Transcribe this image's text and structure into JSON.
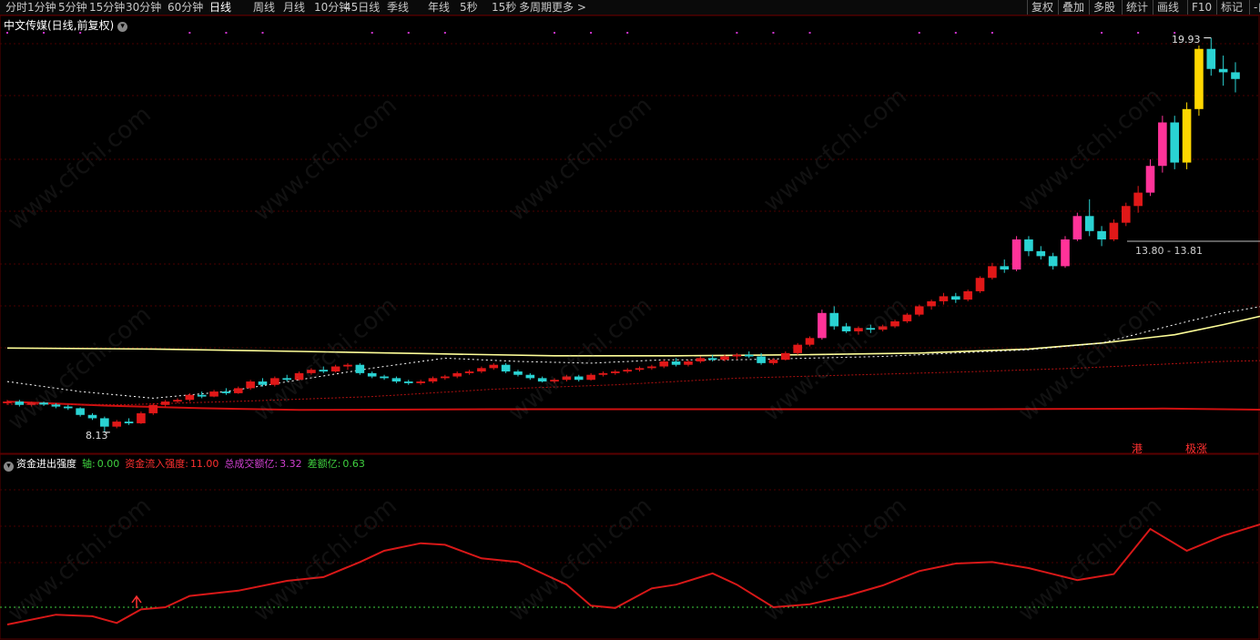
{
  "toolbar": {
    "left_tabs": [
      "分时",
      "1分钟",
      "5分钟",
      "15分钟",
      "30分钟",
      "60分钟",
      "日线",
      "周线",
      "月线",
      "10分钟",
      "45日线",
      "季线",
      "年线",
      "5秒",
      "15秒",
      "多周期",
      "更多 >"
    ],
    "right_tabs": [
      "复权",
      "叠加",
      "多股",
      "统计",
      "画线",
      "F10",
      "标记",
      "-自"
    ]
  },
  "price_panel": {
    "title": "中文传媒(日线,前复权)",
    "high_label": "19.93",
    "low_label": "8.13",
    "crosshair_label": "13.80 - 13.81",
    "tag_hk": "港",
    "tag_rise": "极涨"
  },
  "indicator_panel": {
    "name": "资金进出强度",
    "fields": [
      {
        "label": "轴:",
        "value": "0.00",
        "color": "#3fd13f"
      },
      {
        "label": "资金流入强度:",
        "value": "11.00",
        "color": "#ff3030"
      },
      {
        "label": "总成交额亿:",
        "value": "3.32",
        "color": "#d040d0"
      },
      {
        "label": "差额亿:",
        "value": "0.63",
        "color": "#3fd13f"
      }
    ]
  },
  "watermark": "www.cfchi.com",
  "colors": {
    "up": "#e01818",
    "down": "#2ad3d3",
    "strong_up": "#ff3399",
    "limit_up": "#ffd700",
    "ma_long": "#ffff99",
    "ma_short": "#ffffff",
    "ind_line": "#d81818",
    "grid": "#4a0000"
  },
  "chart_data": [
    {
      "type": "candlestick",
      "title": "中文传媒(日线,前复权)",
      "ylim": [
        7.5,
        20.6
      ],
      "annotations": {
        "high": 19.93,
        "low": 8.13,
        "crosshair": "13.80 - 13.81"
      },
      "candles": [
        [
          9.0,
          9.1,
          8.95,
          9.05
        ],
        [
          9.05,
          9.1,
          8.9,
          8.95
        ],
        [
          8.95,
          9.05,
          8.9,
          9.02
        ],
        [
          9.02,
          9.05,
          8.92,
          8.96
        ],
        [
          8.96,
          9.0,
          8.85,
          8.9
        ],
        [
          8.9,
          8.95,
          8.8,
          8.85
        ],
        [
          8.85,
          8.88,
          8.6,
          8.65
        ],
        [
          8.65,
          8.7,
          8.5,
          8.55
        ],
        [
          8.55,
          8.6,
          8.13,
          8.3
        ],
        [
          8.3,
          8.5,
          8.25,
          8.45
        ],
        [
          8.45,
          8.55,
          8.35,
          8.4
        ],
        [
          8.4,
          8.75,
          8.38,
          8.7
        ],
        [
          8.7,
          9.0,
          8.65,
          8.95
        ],
        [
          8.95,
          9.1,
          8.9,
          9.05
        ],
        [
          9.05,
          9.15,
          9.0,
          9.1
        ],
        [
          9.1,
          9.3,
          9.05,
          9.25
        ],
        [
          9.25,
          9.35,
          9.15,
          9.2
        ],
        [
          9.2,
          9.4,
          9.18,
          9.35
        ],
        [
          9.35,
          9.45,
          9.25,
          9.3
        ],
        [
          9.3,
          9.5,
          9.28,
          9.45
        ],
        [
          9.45,
          9.7,
          9.4,
          9.65
        ],
        [
          9.65,
          9.75,
          9.5,
          9.55
        ],
        [
          9.55,
          9.8,
          9.5,
          9.75
        ],
        [
          9.75,
          9.85,
          9.65,
          9.7
        ],
        [
          9.7,
          9.95,
          9.68,
          9.9
        ],
        [
          9.9,
          10.05,
          9.85,
          10.0
        ],
        [
          10.0,
          10.1,
          9.9,
          9.95
        ],
        [
          9.95,
          10.15,
          9.92,
          10.1
        ],
        [
          10.1,
          10.2,
          10.0,
          10.15
        ],
        [
          10.15,
          10.2,
          9.85,
          9.9
        ],
        [
          9.9,
          9.95,
          9.75,
          9.8
        ],
        [
          9.8,
          9.85,
          9.7,
          9.75
        ],
        [
          9.75,
          9.8,
          9.6,
          9.65
        ],
        [
          9.65,
          9.7,
          9.55,
          9.6
        ],
        [
          9.6,
          9.7,
          9.55,
          9.65
        ],
        [
          9.65,
          9.8,
          9.6,
          9.75
        ],
        [
          9.75,
          9.85,
          9.7,
          9.8
        ],
        [
          9.8,
          9.95,
          9.75,
          9.9
        ],
        [
          9.9,
          10.0,
          9.85,
          9.95
        ],
        [
          9.95,
          10.1,
          9.9,
          10.05
        ],
        [
          10.05,
          10.2,
          10.0,
          10.15
        ],
        [
          10.15,
          10.2,
          9.9,
          9.95
        ],
        [
          9.95,
          10.0,
          9.8,
          9.85
        ],
        [
          9.85,
          9.9,
          9.7,
          9.75
        ],
        [
          9.75,
          9.8,
          9.62,
          9.65
        ],
        [
          9.65,
          9.75,
          9.6,
          9.7
        ],
        [
          9.7,
          9.85,
          9.65,
          9.8
        ],
        [
          9.8,
          9.85,
          9.65,
          9.7
        ],
        [
          9.7,
          9.9,
          9.68,
          9.85
        ],
        [
          9.85,
          9.95,
          9.8,
          9.9
        ],
        [
          9.9,
          10.0,
          9.85,
          9.95
        ],
        [
          9.95,
          10.05,
          9.9,
          10.0
        ],
        [
          10.0,
          10.1,
          9.95,
          10.05
        ],
        [
          10.05,
          10.15,
          10.0,
          10.1
        ],
        [
          10.1,
          10.3,
          10.05,
          10.25
        ],
        [
          10.25,
          10.35,
          10.1,
          10.15
        ],
        [
          10.15,
          10.3,
          10.1,
          10.25
        ],
        [
          10.25,
          10.4,
          10.2,
          10.35
        ],
        [
          10.35,
          10.45,
          10.25,
          10.3
        ],
        [
          10.3,
          10.45,
          10.25,
          10.4
        ],
        [
          10.4,
          10.5,
          10.3,
          10.45
        ],
        [
          10.45,
          10.55,
          10.35,
          10.4
        ],
        [
          10.4,
          10.5,
          10.15,
          10.2
        ],
        [
          10.2,
          10.35,
          10.15,
          10.3
        ],
        [
          10.3,
          10.55,
          10.28,
          10.5
        ],
        [
          10.5,
          10.8,
          10.45,
          10.75
        ],
        [
          10.75,
          11.0,
          10.7,
          10.95
        ],
        [
          10.95,
          11.8,
          10.9,
          11.7
        ],
        [
          11.7,
          11.9,
          11.2,
          11.3
        ],
        [
          11.3,
          11.4,
          11.1,
          11.15
        ],
        [
          11.15,
          11.3,
          11.05,
          11.25
        ],
        [
          11.25,
          11.35,
          11.1,
          11.2
        ],
        [
          11.2,
          11.35,
          11.15,
          11.3
        ],
        [
          11.3,
          11.5,
          11.25,
          11.45
        ],
        [
          11.45,
          11.7,
          11.4,
          11.65
        ],
        [
          11.65,
          11.95,
          11.6,
          11.9
        ],
        [
          11.9,
          12.1,
          11.8,
          12.05
        ],
        [
          12.05,
          12.3,
          11.95,
          12.2
        ],
        [
          12.2,
          12.3,
          12.0,
          12.1
        ],
        [
          12.1,
          12.4,
          12.05,
          12.35
        ],
        [
          12.35,
          12.8,
          12.3,
          12.75
        ],
        [
          12.75,
          13.2,
          12.7,
          13.1
        ],
        [
          13.1,
          13.3,
          12.9,
          13.0
        ],
        [
          13.0,
          14.0,
          12.95,
          13.9
        ],
        [
          13.9,
          14.0,
          13.4,
          13.55
        ],
        [
          13.55,
          13.7,
          13.3,
          13.4
        ],
        [
          13.4,
          13.5,
          13.0,
          13.1
        ],
        [
          13.1,
          14.0,
          13.05,
          13.9
        ],
        [
          13.9,
          14.7,
          13.85,
          14.6
        ],
        [
          14.6,
          15.1,
          14.0,
          14.15
        ],
        [
          14.15,
          14.3,
          13.7,
          13.9
        ],
        [
          13.9,
          14.5,
          13.85,
          14.4
        ],
        [
          14.4,
          15.0,
          14.3,
          14.9
        ],
        [
          14.9,
          15.5,
          14.7,
          15.3
        ],
        [
          15.3,
          16.3,
          15.2,
          16.1
        ],
        [
          16.1,
          17.6,
          15.9,
          17.4
        ],
        [
          17.4,
          17.6,
          16.0,
          16.2
        ],
        [
          16.2,
          18.0,
          16.0,
          17.8
        ],
        [
          17.8,
          19.7,
          17.6,
          19.6
        ],
        [
          19.6,
          19.93,
          18.8,
          19.0
        ],
        [
          19.0,
          19.4,
          18.5,
          18.9
        ],
        [
          18.9,
          19.2,
          18.3,
          18.7
        ]
      ],
      "ma_long": [
        [
          0,
          10.65
        ],
        [
          12,
          10.62
        ],
        [
          24,
          10.55
        ],
        [
          35,
          10.48
        ],
        [
          45,
          10.42
        ],
        [
          55,
          10.42
        ],
        [
          65,
          10.45
        ],
        [
          75,
          10.5
        ],
        [
          84,
          10.62
        ],
        [
          90,
          10.8
        ],
        [
          96,
          11.05
        ],
        [
          100,
          11.35
        ],
        [
          103,
          11.6
        ],
        [
          106,
          11.9
        ],
        [
          109,
          12.3
        ],
        [
          112,
          12.85
        ],
        [
          115,
          13.3
        ],
        [
          117,
          13.55
        ],
        [
          120,
          14.1
        ],
        [
          123,
          14.8
        ],
        [
          126,
          15.5
        ],
        [
          129,
          16.1
        ],
        [
          132,
          16.45
        ]
      ],
      "ma_short_dotted": [
        [
          0,
          9.65
        ],
        [
          6,
          9.35
        ],
        [
          12,
          9.15
        ],
        [
          18,
          9.35
        ],
        [
          24,
          9.7
        ],
        [
          30,
          10.05
        ],
        [
          36,
          10.35
        ],
        [
          42,
          10.25
        ],
        [
          48,
          10.2
        ],
        [
          54,
          10.3
        ],
        [
          60,
          10.3
        ],
        [
          66,
          10.35
        ],
        [
          72,
          10.4
        ],
        [
          78,
          10.5
        ],
        [
          84,
          10.6
        ],
        [
          90,
          10.8
        ],
        [
          96,
          11.35
        ],
        [
          100,
          11.7
        ],
        [
          104,
          11.95
        ],
        [
          108,
          12.3
        ],
        [
          112,
          12.9
        ],
        [
          116,
          13.5
        ],
        [
          119,
          14.1
        ],
        [
          122,
          15.4
        ],
        [
          125,
          16.6
        ],
        [
          128,
          17.8
        ],
        [
          131,
          19.05
        ],
        [
          134,
          19.55
        ],
        [
          136,
          19.85
        ]
      ],
      "lower_dotted_red": [
        [
          0,
          8.97
        ],
        [
          10,
          8.96
        ],
        [
          20,
          9.07
        ],
        [
          30,
          9.2
        ],
        [
          40,
          9.42
        ],
        [
          50,
          9.55
        ],
        [
          60,
          9.75
        ],
        [
          70,
          9.85
        ],
        [
          80,
          9.95
        ],
        [
          88,
          10.05
        ],
        [
          94,
          10.15
        ],
        [
          100,
          10.25
        ],
        [
          106,
          10.3
        ],
        [
          112,
          10.45
        ],
        [
          116,
          10.75
        ],
        [
          120,
          10.95
        ],
        [
          124,
          11.4
        ],
        [
          128,
          11.7
        ],
        [
          132,
          11.92
        ],
        [
          136,
          11.55
        ],
        [
          140,
          12.1
        ]
      ],
      "lower_solid_red": [
        [
          0,
          9.05
        ],
        [
          8,
          8.93
        ],
        [
          16,
          8.85
        ],
        [
          24,
          8.8
        ],
        [
          40,
          8.82
        ],
        [
          60,
          8.82
        ],
        [
          80,
          8.82
        ],
        [
          95,
          8.84
        ],
        [
          105,
          8.8
        ],
        [
          112,
          8.72
        ],
        [
          116,
          8.58
        ]
      ]
    },
    {
      "type": "line",
      "title": "资金进出强度",
      "ylim": [
        -4,
        19
      ],
      "zero_axis": 0.0,
      "series": [
        {
          "name": "资金流入强度",
          "points": [
            [
              0,
              -2.3
            ],
            [
              4,
              -1.0
            ],
            [
              7,
              -1.2
            ],
            [
              9,
              -2.1
            ],
            [
              11,
              -0.3
            ],
            [
              13,
              0.0
            ],
            [
              15,
              1.5
            ],
            [
              19,
              2.2
            ],
            [
              23,
              3.5
            ],
            [
              26,
              4.0
            ],
            [
              29,
              6.0
            ],
            [
              31,
              7.5
            ],
            [
              34,
              8.5
            ],
            [
              36,
              8.3
            ],
            [
              39,
              6.5
            ],
            [
              42,
              6.0
            ],
            [
              46,
              3.0
            ],
            [
              48,
              0.2
            ],
            [
              50,
              -0.1
            ],
            [
              53,
              2.5
            ],
            [
              55,
              3.0
            ],
            [
              58,
              4.5
            ],
            [
              60,
              3.0
            ],
            [
              63,
              0.0
            ],
            [
              66,
              0.4
            ],
            [
              69,
              1.5
            ],
            [
              72,
              2.9
            ],
            [
              75,
              4.8
            ],
            [
              78,
              5.8
            ],
            [
              81,
              6.0
            ],
            [
              84,
              5.2
            ],
            [
              88,
              3.6
            ],
            [
              91,
              4.4
            ],
            [
              94,
              10.4
            ],
            [
              97,
              7.5
            ],
            [
              100,
              9.5
            ],
            [
              103,
              11.0
            ],
            [
              106,
              10.0
            ],
            [
              109,
              12.3
            ],
            [
              111,
              11.0
            ],
            [
              114,
              9.0
            ],
            [
              117,
              12.5
            ],
            [
              120,
              7.0
            ],
            [
              122,
              6.5
            ],
            [
              124,
              7.5
            ],
            [
              126,
              6.2
            ],
            [
              129,
              8.0
            ],
            [
              132,
              3.8
            ]
          ]
        }
      ]
    }
  ]
}
